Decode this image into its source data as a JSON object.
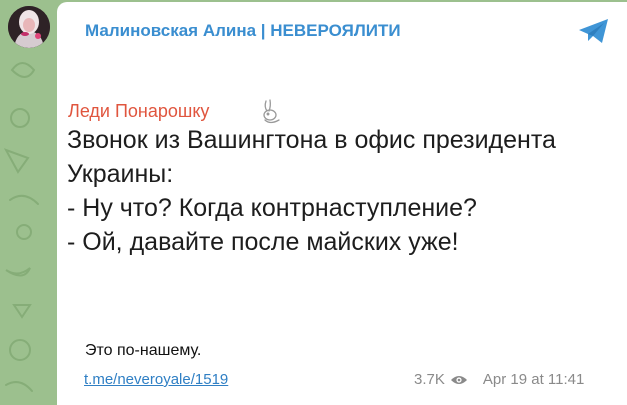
{
  "channel": {
    "title": "Малиновская Алина | НЕВЕРОЯЛИТИ"
  },
  "post": {
    "image": {
      "author": "Леди Понарошку",
      "lines": [
        "Звонок из Вашингтона в офис президента",
        "Украины:",
        "- Ну что? Когда контрнаступление?",
        "- Ой, давайте после майских уже!"
      ]
    },
    "caption": "Это по-нашему.",
    "link": "t.me/neveroyale/1519",
    "views": "3.7K",
    "date": "Apr 19 at 11:41"
  },
  "colors": {
    "background": "#9cc08e",
    "channel_title": "#3a8ed0",
    "quote_author": "#e0553e",
    "link": "#2f7fc4"
  },
  "icons": {
    "share": "telegram-plane-icon",
    "views": "eye-icon",
    "author_badge": "rabbit-icon"
  }
}
